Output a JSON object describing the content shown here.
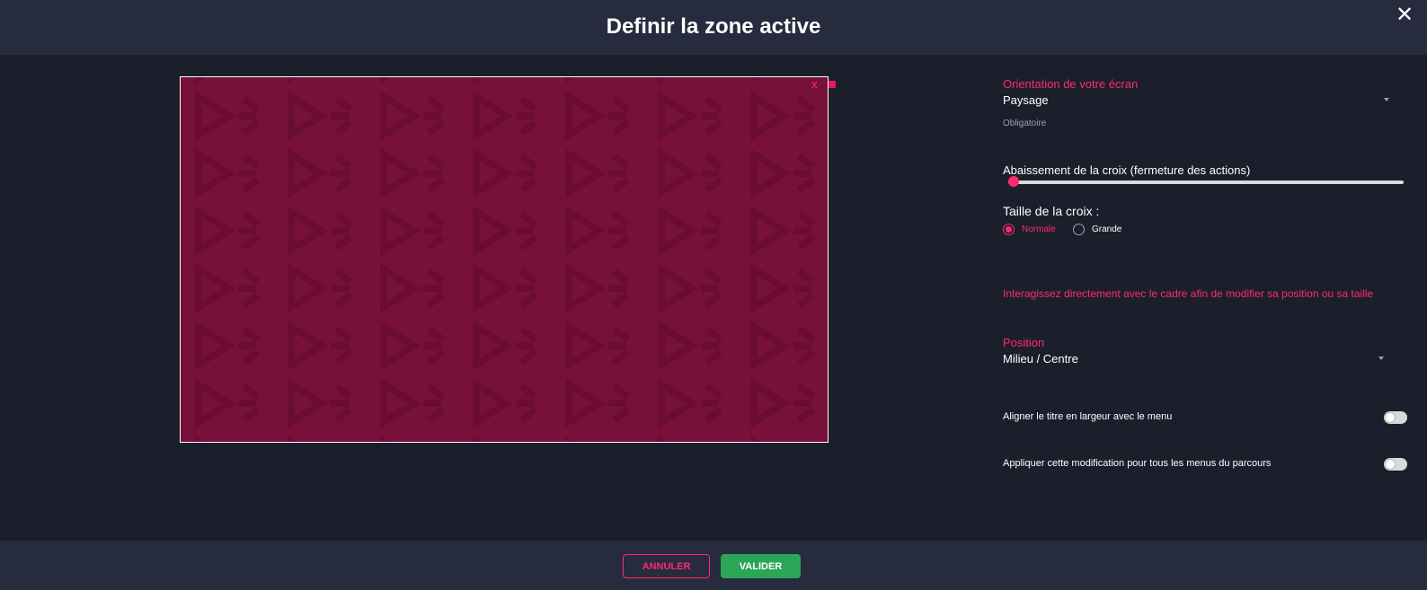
{
  "header": {
    "title": "Definir la zone active",
    "close_icon": "close-icon"
  },
  "preview": {
    "close_label": "x",
    "background_color": "#781139",
    "accent_color": "#e6195f"
  },
  "settings": {
    "orientation": {
      "label": "Orientation de votre écran",
      "value": "Paysage",
      "helper": "Obligatoire"
    },
    "cross_lowering": {
      "label": "Abaissement de la croix (fermeture des actions)",
      "value": 0
    },
    "cross_size": {
      "label": "Taille de la croix :",
      "options": [
        {
          "label": "Normale",
          "checked": true
        },
        {
          "label": "Grande",
          "checked": false
        }
      ]
    },
    "instruction": "Interagissez directement avec le cadre afin de modifier sa position ou sa taille",
    "position": {
      "label": "Position",
      "value": "Milieu / Centre"
    },
    "align_title": {
      "label": "Aligner le titre en largeur avec le menu",
      "enabled": false
    },
    "apply_all": {
      "label": "Appliquer cette modification pour tous les menus du parcours",
      "enabled": false
    }
  },
  "footer": {
    "cancel_label": "ANNULER",
    "validate_label": "VALIDER"
  },
  "colors": {
    "background": "#1b1f2c",
    "bar": "#262b3d",
    "accent": "#ff2a6d",
    "success": "#2ba556"
  }
}
